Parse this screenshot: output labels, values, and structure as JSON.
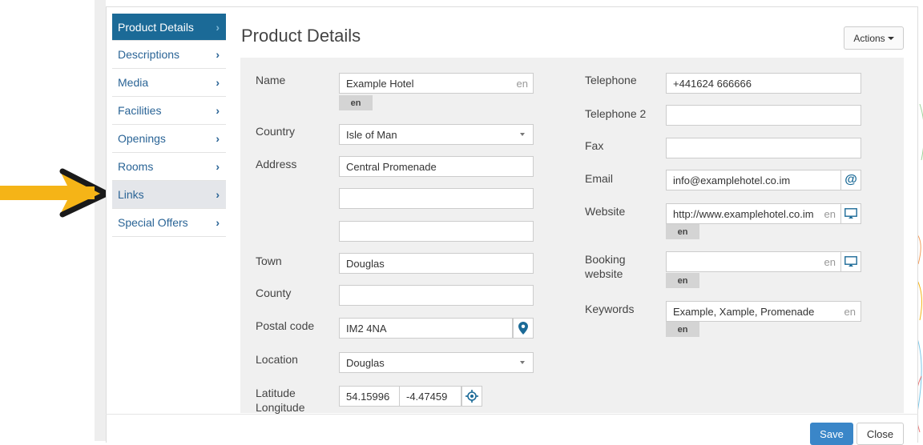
{
  "sidebar": {
    "items": [
      {
        "label": "Product Details"
      },
      {
        "label": "Descriptions"
      },
      {
        "label": "Media"
      },
      {
        "label": "Facilities"
      },
      {
        "label": "Openings"
      },
      {
        "label": "Rooms"
      },
      {
        "label": "Links"
      },
      {
        "label": "Special Offers"
      }
    ]
  },
  "header": {
    "title": "Product Details",
    "actions_label": "Actions"
  },
  "form": {
    "name_label": "Name",
    "name_value": "Example Hotel",
    "lang_code": "en",
    "country_label": "Country",
    "country_value": "Isle of Man",
    "address_label": "Address",
    "address1": "Central Promenade",
    "address2": "",
    "address3": "",
    "town_label": "Town",
    "town_value": "Douglas",
    "county_label": "County",
    "county_value": "",
    "postal_label": "Postal code",
    "postal_value": "IM2 4NA",
    "location_label": "Location",
    "location_value": "Douglas",
    "latitude_label": "Latitude",
    "longitude_label": "Longitude",
    "latitude_value": "54.15996",
    "longitude_value": "-4.47459",
    "telephone_label": "Telephone",
    "telephone_value": "+441624 666666",
    "telephone2_label": "Telephone 2",
    "telephone2_value": "",
    "fax_label": "Fax",
    "fax_value": "",
    "email_label": "Email",
    "email_value": "info@examplehotel.co.im",
    "website_label": "Website",
    "website_value": "http://www.examplehotel.co.im",
    "booking_label_1": "Booking",
    "booking_label_2": "website",
    "booking_value": "",
    "keywords_label": "Keywords",
    "keywords_value": "Example, Xample, Promenade"
  },
  "footer": {
    "save_label": "Save",
    "close_label": "Close"
  },
  "colors": {
    "accent": "#1b6a97",
    "save": "#3a86c8",
    "arrow": "#f5b417",
    "panel": "#f0f0f0"
  }
}
